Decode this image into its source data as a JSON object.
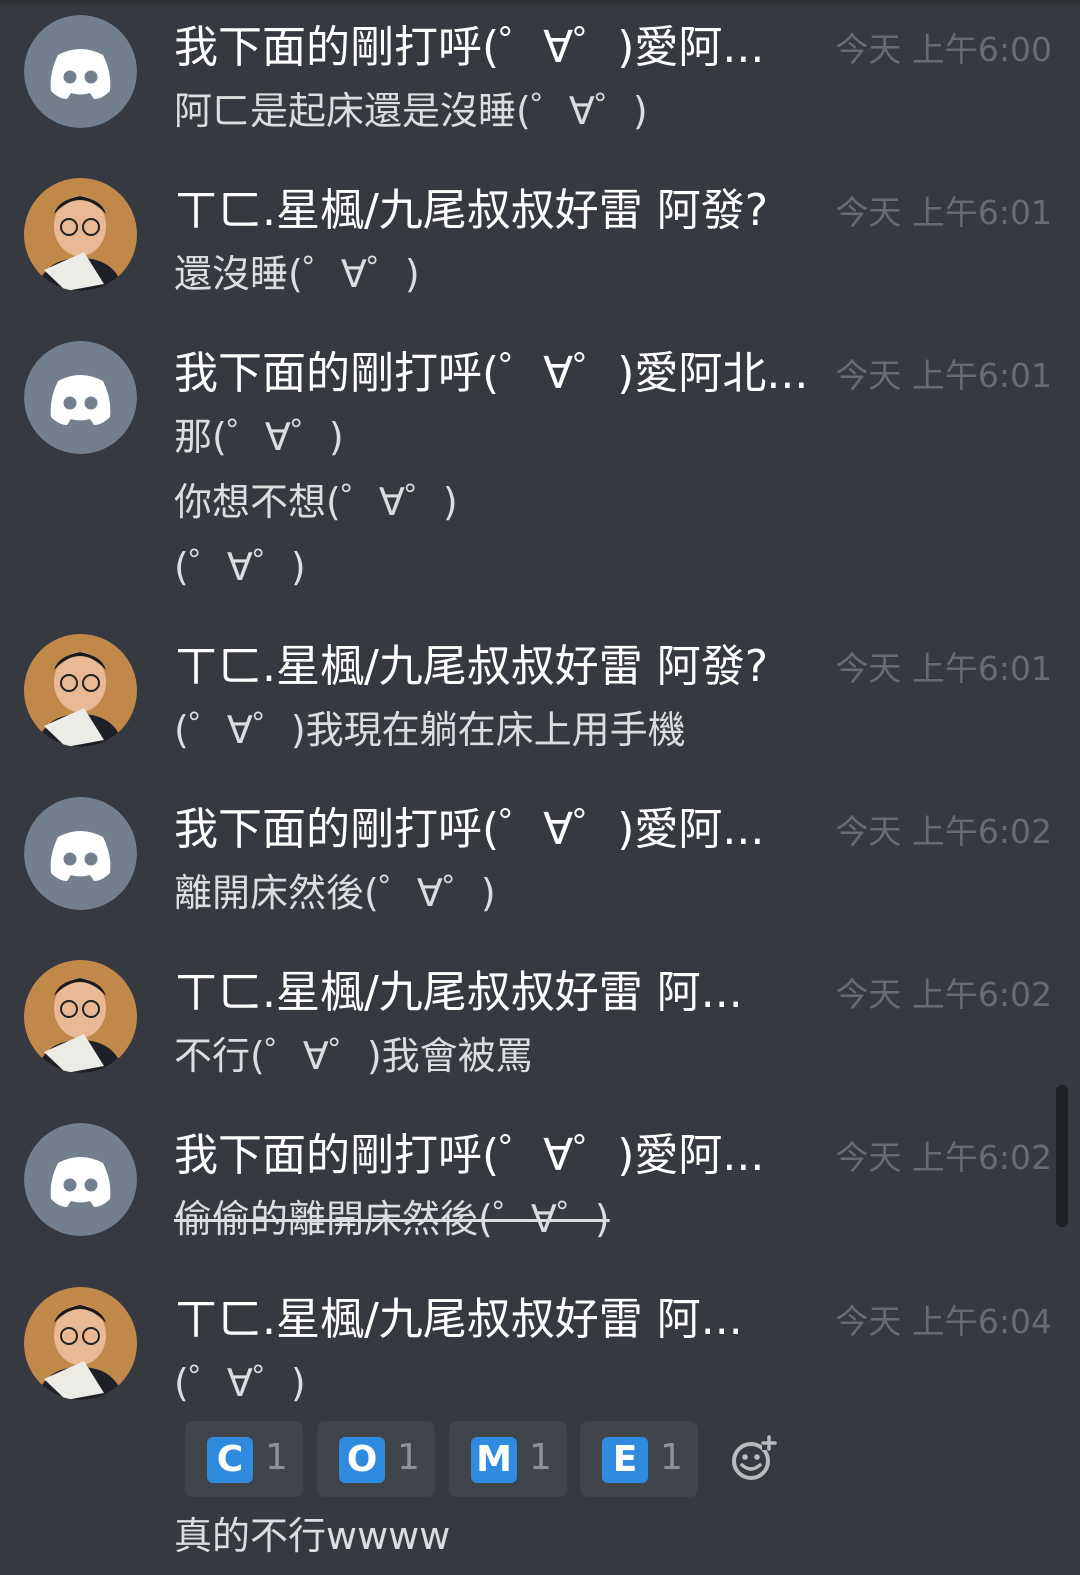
{
  "messages": [
    {
      "author": "我下面的剛打呼(゜∀゜)愛阿...",
      "timestamp": "今天 上午6:00",
      "lines": [
        "阿ㄈ是起床還是沒睡(゜∀゜)"
      ]
    },
    {
      "author": "ㄒㄈ.星楓/九尾叔叔好雷 阿發?",
      "timestamp": "今天 上午6:01",
      "lines": [
        "還沒睡(゜∀゜)"
      ]
    },
    {
      "author": "我下面的剛打呼(゜∀゜)愛阿北...",
      "timestamp": "今天 上午6:01",
      "lines": [
        "那(゜∀゜)",
        "你想不想(゜∀゜)",
        "(゜∀゜)"
      ]
    },
    {
      "author": "ㄒㄈ.星楓/九尾叔叔好雷 阿發?",
      "timestamp": "今天 上午6:01",
      "lines": [
        "(゜∀゜)我現在躺在床上用手機"
      ]
    },
    {
      "author": "我下面的剛打呼(゜∀゜)愛阿...",
      "timestamp": "今天 上午6:02",
      "lines": [
        "離開床然後(゜∀゜)"
      ]
    },
    {
      "author": "ㄒㄈ.星楓/九尾叔叔好雷 阿...",
      "timestamp": "今天 上午6:02",
      "lines": [
        "不行(゜∀゜)我會被罵"
      ]
    },
    {
      "author": "我下面的剛打呼(゜∀゜)愛阿...",
      "timestamp": "今天 上午6:02",
      "lines": [
        "偷偷的離開床然後(゜∀゜)"
      ]
    },
    {
      "author": "ㄒㄈ.星楓/九尾叔叔好雷 阿...",
      "timestamp": "今天 上午6:04",
      "lines": [
        "(゜∀゜)",
        "真的不行wwww"
      ]
    }
  ],
  "reactions": [
    {
      "emoji": "C",
      "count": "1"
    },
    {
      "emoji": "O",
      "count": "1"
    },
    {
      "emoji": "M",
      "count": "1"
    },
    {
      "emoji": "E",
      "count": "1"
    }
  ],
  "icons": {
    "discord_avatar": "discord-default-avatar-icon",
    "add_reaction": "add-reaction-icon"
  },
  "colors": {
    "background": "#36393f",
    "discord_avatar_bg": "#747f8d",
    "reaction_emoji_bg": "#2f8be0",
    "timestamp": "#686b71"
  }
}
